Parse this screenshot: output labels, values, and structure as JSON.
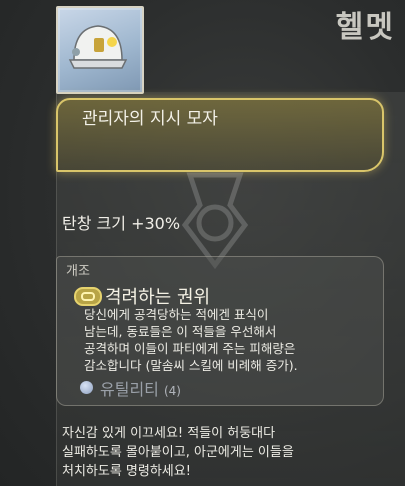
{
  "category_title": "헬멧",
  "item": {
    "name": "관리자의 지시 모자",
    "icon": "helmet-icon",
    "rarity_color": "#d9c56a"
  },
  "stat": {
    "label": "탄창 크기",
    "value": "+30%"
  },
  "mod": {
    "header": "개조",
    "icon": "mod-pill-icon",
    "title": "격려하는 권위",
    "description_lines": [
      "당신에게 공격당하는 적에겐 표식이",
      "남는데, 동료들은 이 적들을 우선해서",
      "공격하며 이들이 파티에게 주는 피해량은",
      "감소합니다 (말솜씨 스킬에 비례해 증가)."
    ],
    "utility": {
      "icon": "utility-orb-icon",
      "label": "유틸리티",
      "count": "(4)"
    }
  },
  "flavor_lines": [
    "자신감 있게 이끄세요! 적들이 허둥대다",
    "실패하도록 몰아붙이고, 아군에게는 이들을",
    "처치하도록 명령하세요!"
  ]
}
